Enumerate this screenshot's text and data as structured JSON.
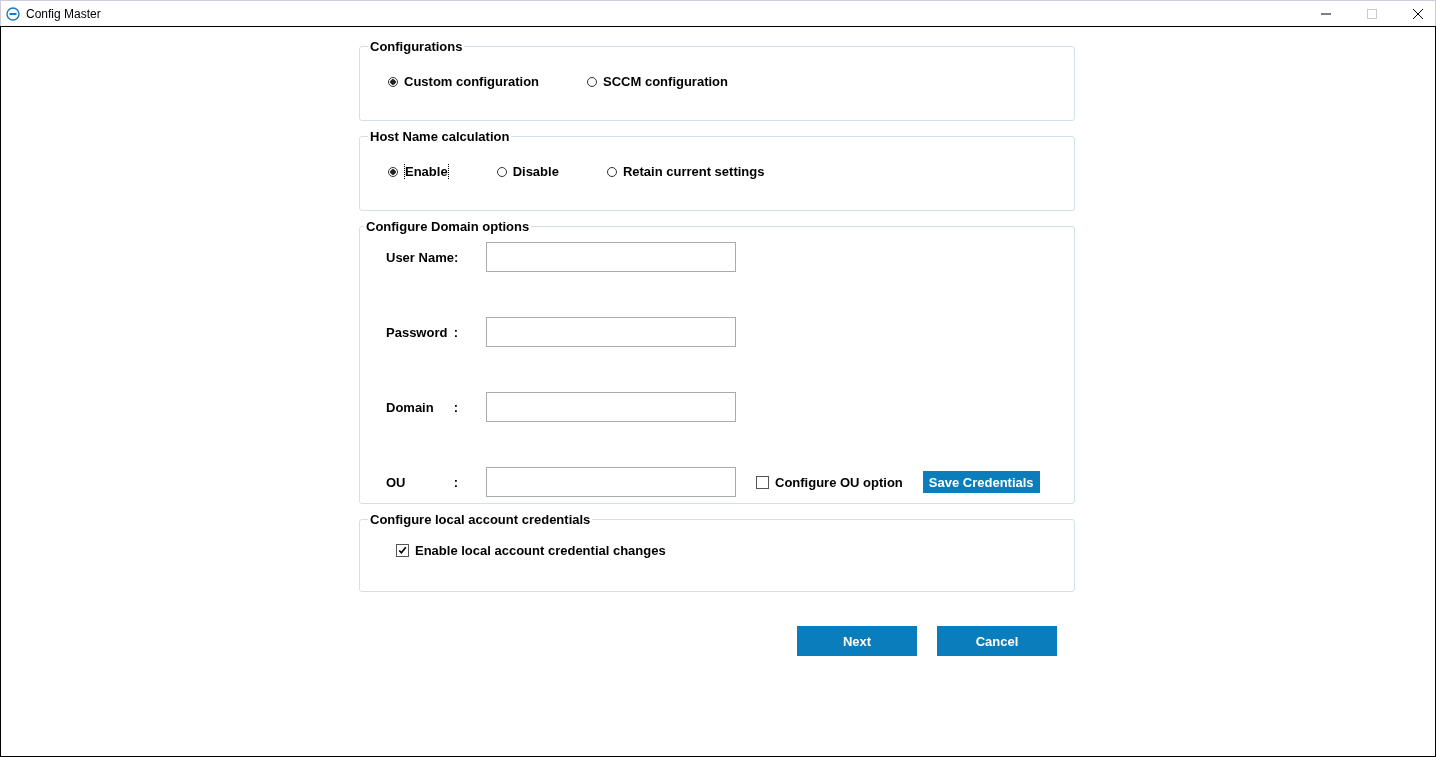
{
  "window": {
    "title": "Config Master"
  },
  "configurations": {
    "title": "Configurations",
    "options": [
      {
        "label": "Custom configuration",
        "selected": true
      },
      {
        "label": "SCCM configuration",
        "selected": false
      }
    ]
  },
  "host_name": {
    "title": "Host Name calculation",
    "options": [
      {
        "label": "Enable",
        "selected": true
      },
      {
        "label": "Disable",
        "selected": false
      },
      {
        "label": "Retain current settings",
        "selected": false
      }
    ]
  },
  "domain": {
    "title": "Configure Domain options",
    "fields": [
      {
        "label": "User Name:"
      },
      {
        "label": "Password",
        "colon": ":"
      },
      {
        "label": "Domain",
        "colon": ":"
      },
      {
        "label": "OU",
        "colon": ":"
      }
    ],
    "ou_option": {
      "label": "Configure OU option",
      "checked": false
    },
    "save_button": "Save Credentials"
  },
  "local_account": {
    "title": "Configure local account credentials",
    "option": {
      "label": "Enable local account credential changes",
      "checked": true
    }
  },
  "buttons": [
    "Next",
    "Cancel"
  ]
}
